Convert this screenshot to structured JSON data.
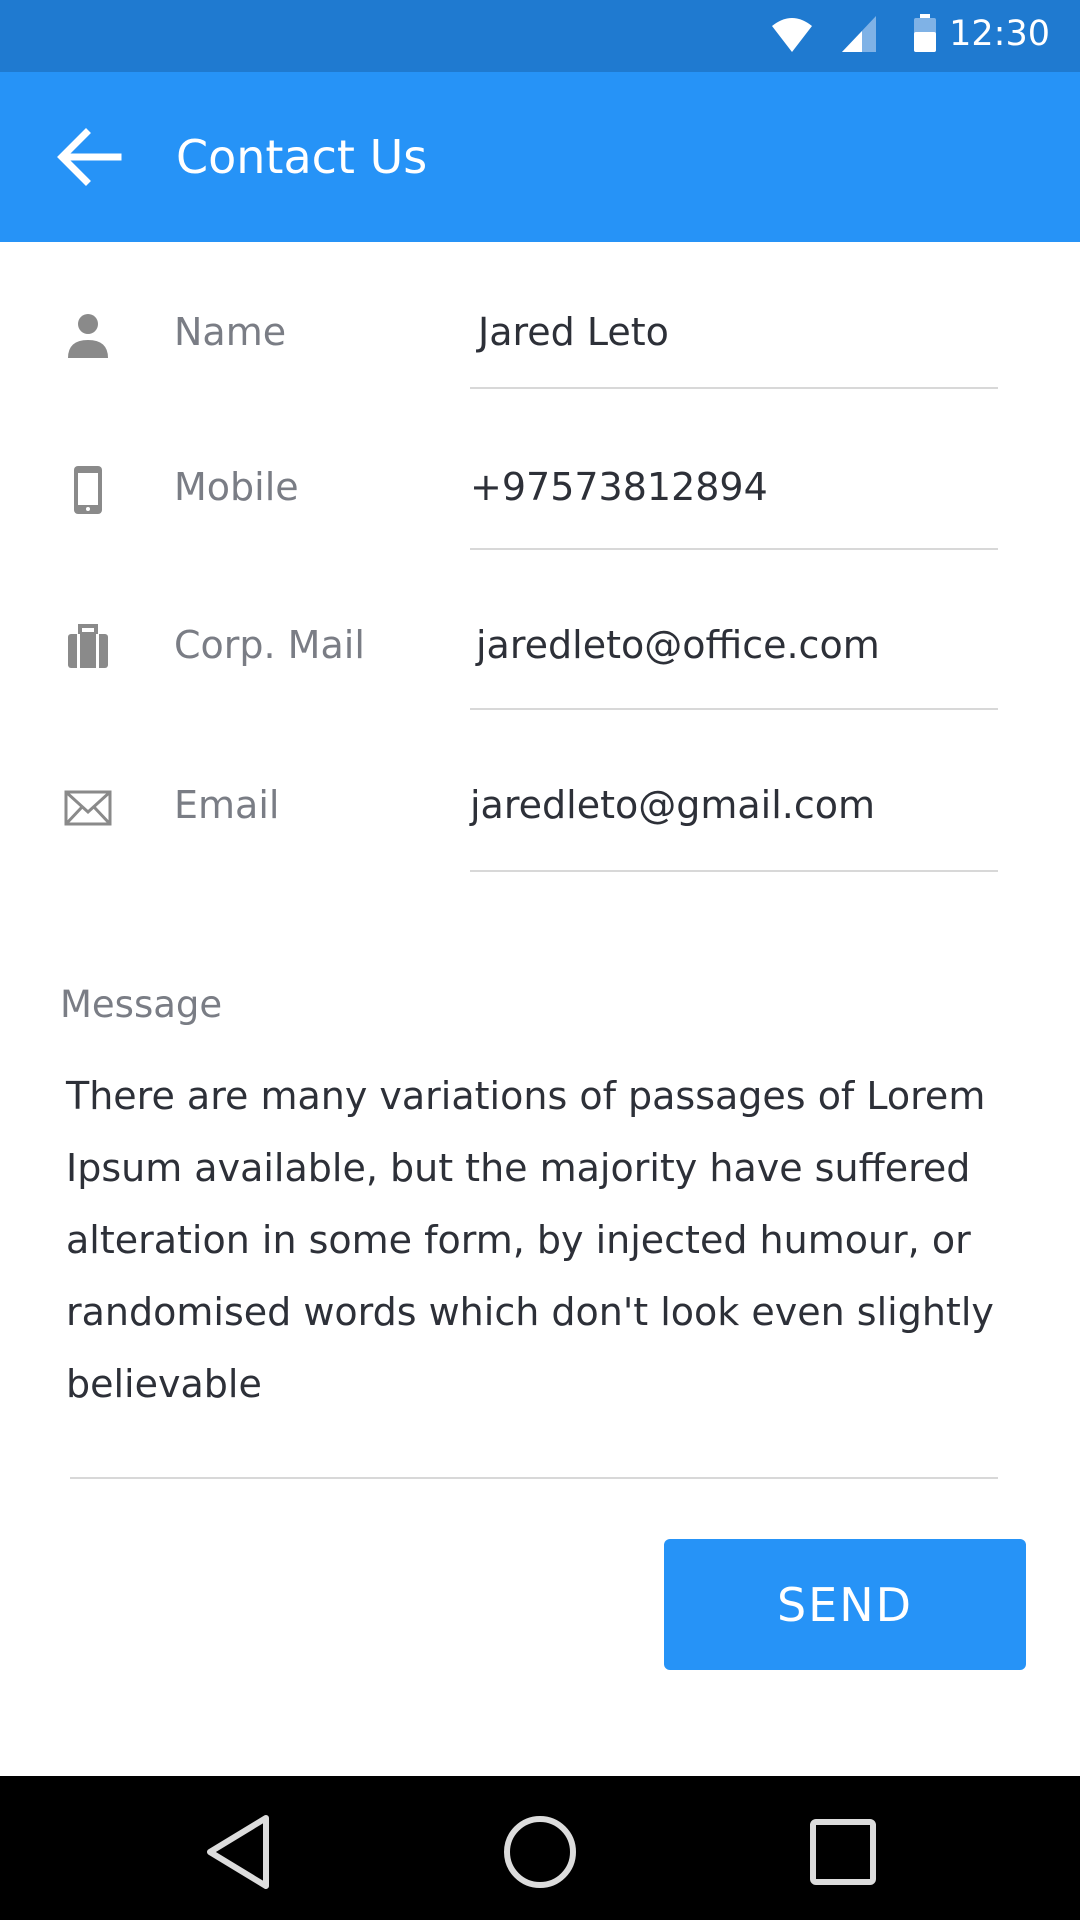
{
  "status_bar": {
    "time": "12:30",
    "icons": [
      "wifi-icon",
      "cell-signal-icon",
      "battery-icon"
    ]
  },
  "app_bar": {
    "title": "Contact Us",
    "back_icon": "arrow-left-icon",
    "color": "#2693f7"
  },
  "form": {
    "fields": [
      {
        "icon": "person-icon",
        "label": "Name",
        "value": "Jared Leto"
      },
      {
        "icon": "mobile-phone-icon",
        "label": "Mobile",
        "value": "+97573812894"
      },
      {
        "icon": "briefcase-icon",
        "label": "Corp. Mail",
        "value": "jaredleto@office.com"
      },
      {
        "icon": "envelope-icon",
        "label": "Email",
        "value": "jaredleto@gmail.com"
      }
    ],
    "message_label": "Message",
    "message_value": "There are many variations of passages of Lorem Ipsum available, but the majority have suffered alteration in some form, by injected humour, or randomised words which don't look even slightly believable",
    "send_label": "SEND"
  },
  "nav_bar": {
    "buttons": [
      "back-triangle-icon",
      "home-circle-icon",
      "recents-square-icon"
    ]
  }
}
